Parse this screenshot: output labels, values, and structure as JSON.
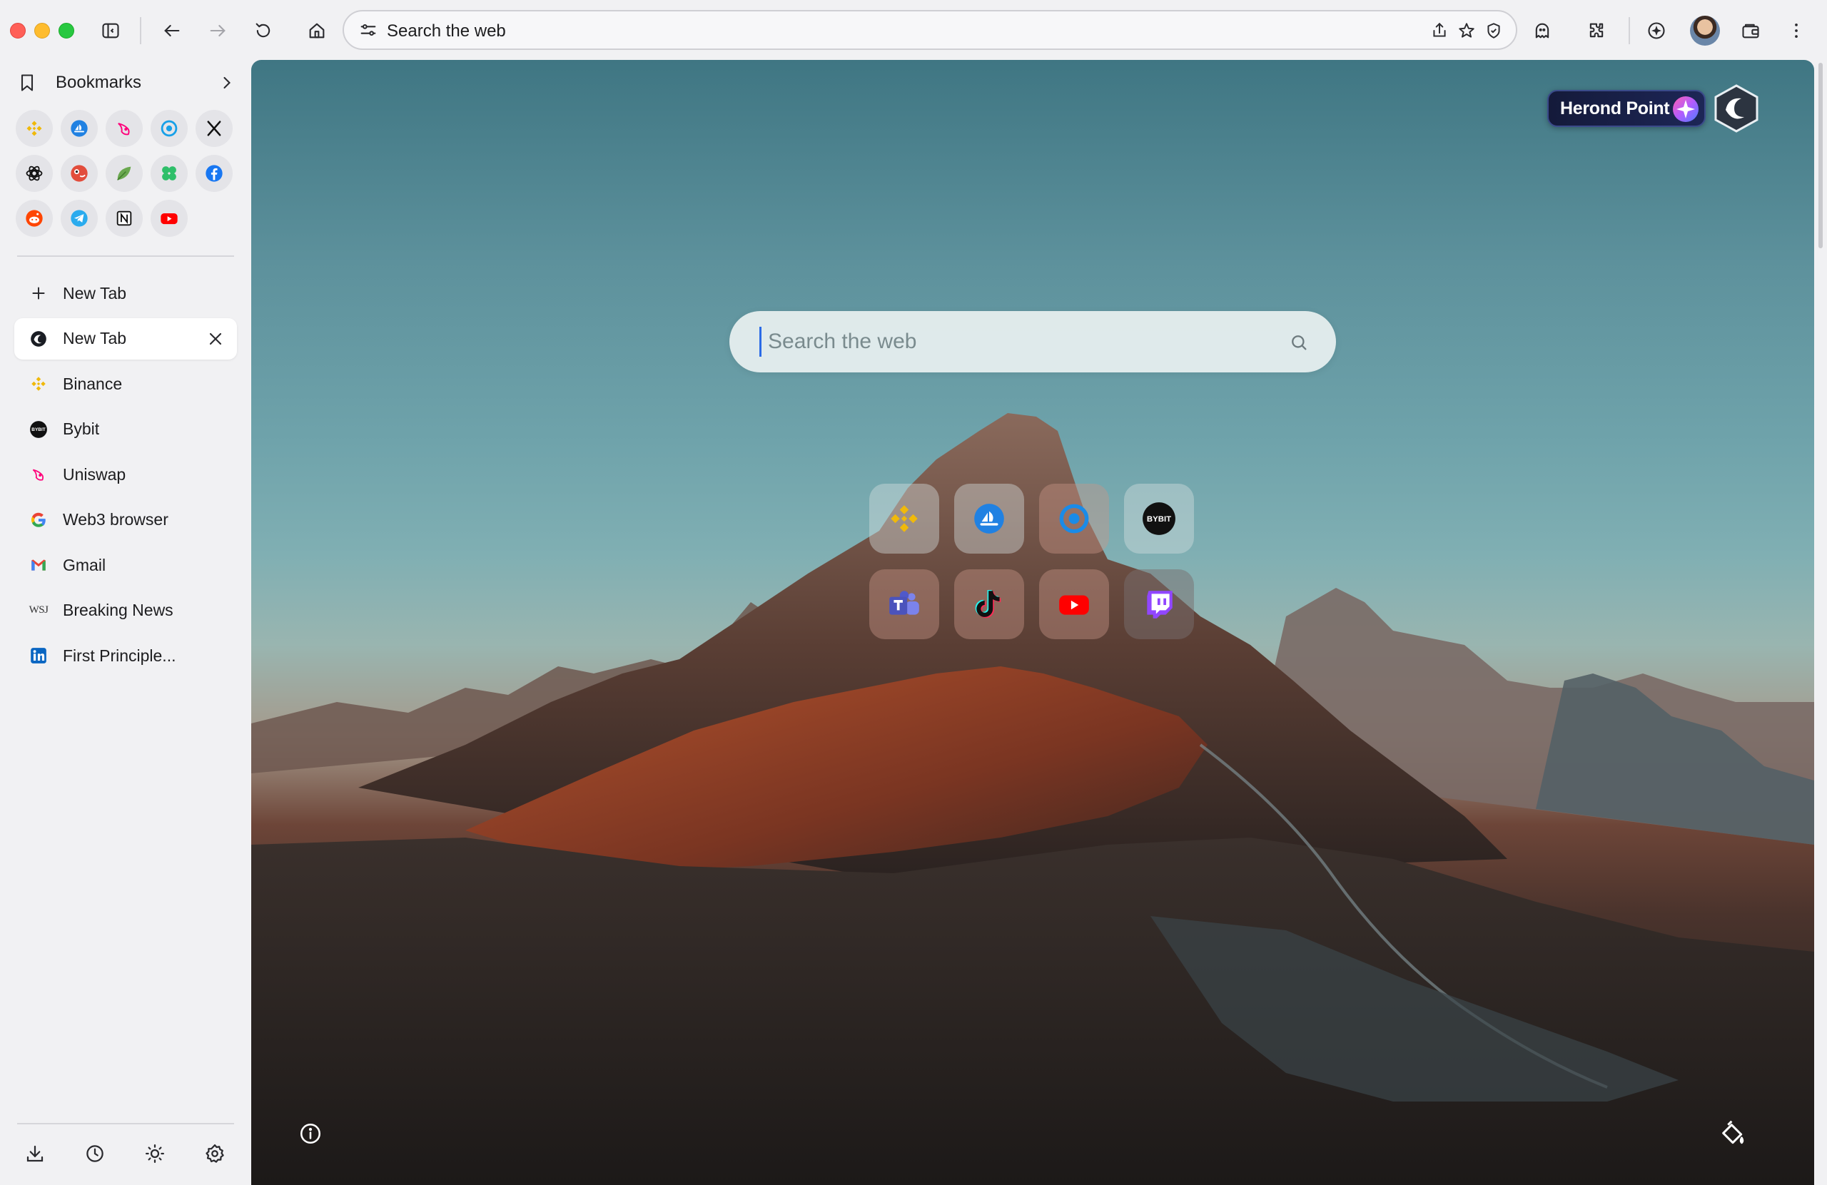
{
  "toolbar": {
    "omnibox_text": "Search the web",
    "icons": [
      "sidebar-toggle-icon",
      "back-icon",
      "forward-icon",
      "reload-icon",
      "home-icon",
      "tune-icon",
      "share-icon",
      "star-icon",
      "shield-icon",
      "wallet-ghost-icon",
      "extensions-icon",
      "herond-badge-icon",
      "avatar",
      "wallet-icon",
      "more-icon"
    ]
  },
  "sidebar": {
    "bookmarks_label": "Bookmarks",
    "favorites": [
      "binance",
      "opensea",
      "uniswap",
      "coinmarketcap",
      "x",
      "chatgpt",
      "coingecko",
      "leaf",
      "clover",
      "facebook",
      "reddit",
      "telegram",
      "notion",
      "youtube"
    ],
    "new_tab_label": "New Tab",
    "tabs": [
      {
        "label": "New Tab",
        "icon": "herond-icon",
        "active": true
      },
      {
        "label": "Binance",
        "icon": "binance-icon"
      },
      {
        "label": "Bybit",
        "icon": "bybit-icon"
      },
      {
        "label": "Uniswap",
        "icon": "uniswap-icon"
      },
      {
        "label": "Web3 browser",
        "icon": "google-icon"
      },
      {
        "label": "Gmail",
        "icon": "gmail-icon"
      },
      {
        "label": "Breaking News",
        "icon": "wsj-icon"
      },
      {
        "label": "First Principle...",
        "icon": "linkedin-icon"
      }
    ],
    "bottom_icons": [
      "download-icon",
      "history-icon",
      "theme-icon",
      "settings-icon"
    ]
  },
  "main": {
    "herond_point_label": "Herond Point",
    "search_placeholder": "Search the web",
    "shortcuts": [
      "binance",
      "opensea",
      "coinmarketcap",
      "bybit",
      "teams",
      "tiktok",
      "youtube",
      "twitch"
    ],
    "bybit_logo_text": "BYBIT",
    "wsj_text": "WSJ"
  },
  "colors": {
    "accent": "#2b6be6",
    "binance": "#F0B90B",
    "opensea": "#2081E2",
    "uniswap": "#FF007A",
    "youtube": "#FF0000",
    "twitch": "#9146FF",
    "facebook": "#1877F2",
    "telegram": "#2AABEE",
    "linkedin": "#0A66C2"
  }
}
